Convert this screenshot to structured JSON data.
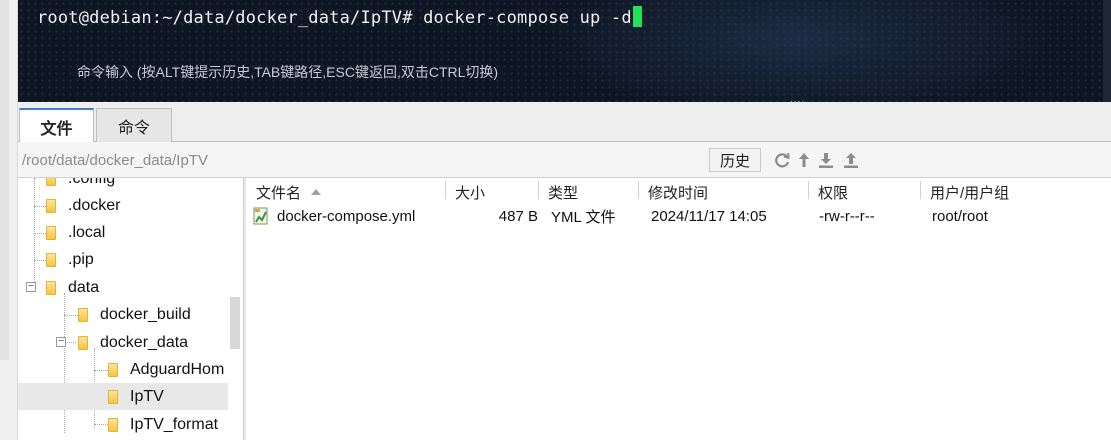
{
  "terminal": {
    "prompt": "root@debian:~/data/docker_data/IpTV# docker-compose up -d",
    "hint": "命令输入 (按ALT键提示历史,TAB键路径,ESC键返回,双击CTRL切换)",
    "resize_handle": "....",
    "cursor_color": "#22e05a"
  },
  "tabs": [
    {
      "label": "文件",
      "active": true
    },
    {
      "label": "命令",
      "active": false
    }
  ],
  "pathbar": {
    "path": "/root/data/docker_data/IpTV",
    "history_label": "历史",
    "toolbar_icons": [
      "refresh-icon",
      "up-directory-icon",
      "download-icon",
      "upload-icon"
    ]
  },
  "tree": {
    "items": [
      {
        "label": ".config"
      },
      {
        "label": ".docker"
      },
      {
        "label": ".local"
      },
      {
        "label": ".pip"
      },
      {
        "label": "data",
        "expanded": true
      },
      {
        "label": "docker_build"
      },
      {
        "label": "docker_data",
        "expanded": true
      },
      {
        "label": "AdguardHom"
      },
      {
        "label": "IpTV",
        "selected": true
      },
      {
        "label": "IpTV_format"
      }
    ]
  },
  "filelist": {
    "columns": [
      "文件名",
      "大小",
      "类型",
      "修改时间",
      "权限",
      "用户/用户组"
    ],
    "files": [
      {
        "name": "docker-compose.yml",
        "size": "487 B",
        "type": "YML 文件",
        "modified": "2024/11/17 14:05",
        "permissions": "-rw-r--r--",
        "owner": "root/root"
      }
    ]
  },
  "colors": {
    "terminal_bg": "#0e1623",
    "active_tab_accent": "#3b7fd4",
    "folder": "#f4c542"
  }
}
